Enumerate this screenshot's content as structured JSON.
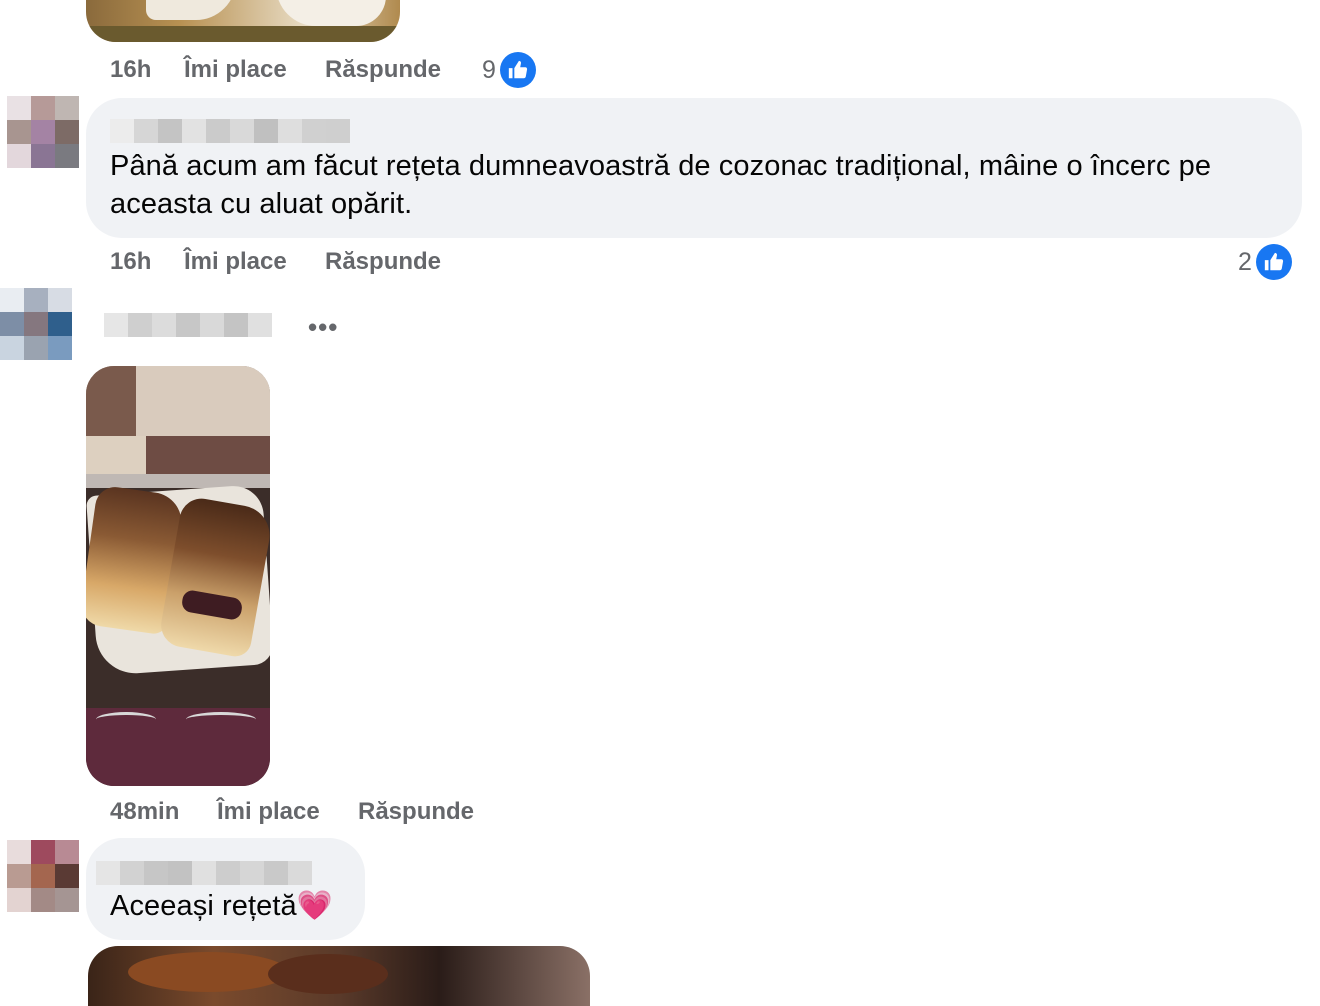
{
  "comments": [
    {
      "time": "16h",
      "like_label": "Îmi place",
      "reply_label": "Răspunde",
      "reaction_count": "9"
    },
    {
      "text_line1": "Până acum am făcut rețeta dumneavoastră de cozonac tradițional, mâine o încerc pe",
      "text_line2": "aceasta cu aluat opărit.",
      "time": "16h",
      "like_label": "Îmi place",
      "reply_label": "Răspunde",
      "reaction_count": "2"
    },
    {
      "more_label": "•••",
      "time": "48min",
      "like_label": "Îmi place",
      "reply_label": "Răspunde"
    },
    {
      "text": "Aceeași rețetă",
      "emoji": "💗"
    }
  ],
  "colors": {
    "bubble": "#f0f2f5",
    "meta_text": "#65676b",
    "like_blue": "#1877f2"
  },
  "icons": {
    "reaction": "like-icon",
    "emoji": "pink-heart-emoji"
  }
}
